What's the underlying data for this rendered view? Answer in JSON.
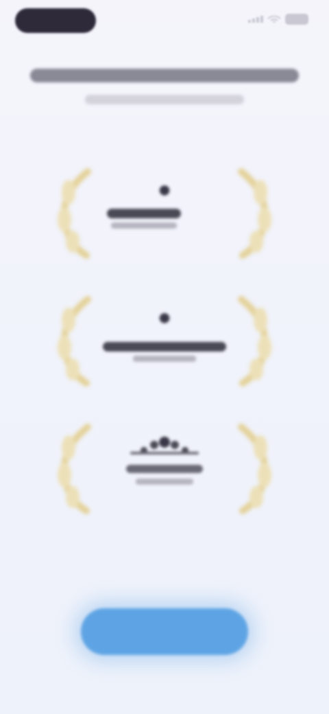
{
  "status_bar": {
    "time": "",
    "icons": [
      "signal-icon",
      "wifi-icon",
      "battery-icon"
    ]
  },
  "header": {
    "title": "",
    "subtitle": ""
  },
  "awards": [
    {
      "icon": "apple-icon",
      "title": "",
      "subtitle": ""
    },
    {
      "icon": "apple-icon",
      "title": "",
      "subtitle": ""
    },
    {
      "icon": "stars-icon",
      "title": "",
      "subtitle": ""
    }
  ],
  "cta": {
    "label": ""
  },
  "colors": {
    "laurel": "#e4d29a",
    "accent": "#5ea4e4",
    "background": "#f3f3fb"
  }
}
